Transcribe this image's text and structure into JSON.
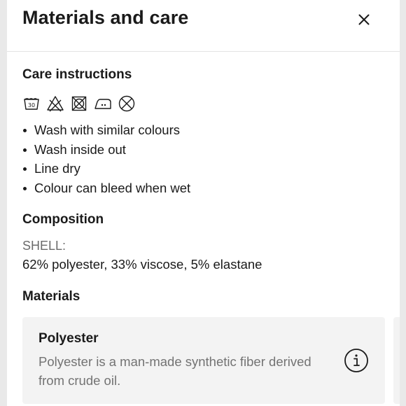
{
  "header": {
    "title": "Materials and care",
    "close_icon": "close-icon"
  },
  "care_instructions": {
    "heading": "Care instructions",
    "icons": [
      {
        "name": "wash-30-icon",
        "label": "30"
      },
      {
        "name": "do-not-bleach-icon"
      },
      {
        "name": "do-not-tumble-dry-icon"
      },
      {
        "name": "iron-medium-icon"
      },
      {
        "name": "do-not-dry-clean-icon"
      }
    ],
    "items": [
      "Wash with similar colours",
      "Wash inside out",
      "Line dry",
      "Colour can bleed when wet"
    ]
  },
  "composition": {
    "heading": "Composition",
    "label": "SHELL:",
    "value": "62% polyester, 33% viscose, 5% elastane"
  },
  "materials": {
    "heading": "Materials",
    "cards": [
      {
        "title": "Polyester",
        "description": "Polyester is a man-made synthetic fiber derived from crude oil.",
        "info_icon": "info-icon"
      }
    ]
  }
}
